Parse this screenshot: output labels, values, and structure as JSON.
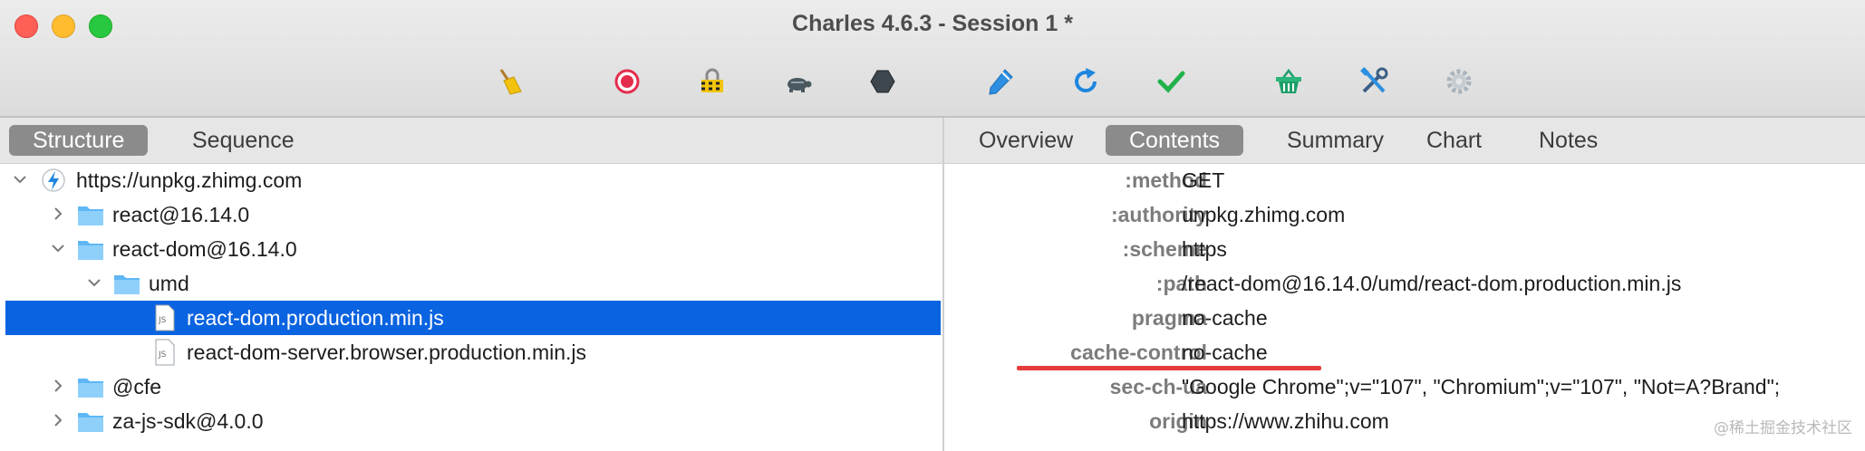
{
  "window": {
    "title": "Charles 4.6.3 - Session 1 *"
  },
  "toolbar": {
    "tools": [
      {
        "name": "broom-icon"
      },
      {
        "name": "record-icon"
      },
      {
        "name": "ssl-lock-icon"
      },
      {
        "name": "turtle-throttle-icon"
      },
      {
        "name": "stop-hexagon-icon"
      },
      {
        "name": "compose-pen-icon"
      },
      {
        "name": "repeat-refresh-icon"
      },
      {
        "name": "validate-check-icon"
      },
      {
        "name": "basket-icon"
      },
      {
        "name": "tools-icon"
      },
      {
        "name": "settings-gear-icon"
      }
    ]
  },
  "left_tabs": {
    "structure": "Structure",
    "sequence": "Sequence",
    "active": "Structure"
  },
  "tree": {
    "host": "https://unpkg.zhimg.com",
    "react": "react@16.14.0",
    "react_dom": "react-dom@16.14.0",
    "umd": "umd",
    "file_selected": "react-dom.production.min.js",
    "file_server": "react-dom-server.browser.production.min.js",
    "cfe": "@cfe",
    "za_sdk": "za-js-sdk@4.0.0",
    "js_badge": "JS"
  },
  "right_tabs": {
    "overview": "Overview",
    "contents": "Contents",
    "summary": "Summary",
    "chart": "Chart",
    "notes": "Notes",
    "active": "Contents"
  },
  "headers": [
    {
      "key": ":method",
      "value": "GET"
    },
    {
      "key": ":authority",
      "value": "unpkg.zhimg.com"
    },
    {
      "key": ":scheme",
      "value": "https"
    },
    {
      "key": ":path",
      "value": "/react-dom@16.14.0/umd/react-dom.production.min.js"
    },
    {
      "key": "pragma",
      "value": "no-cache"
    },
    {
      "key": "cache-control",
      "value": "no-cache"
    },
    {
      "key": "sec-ch-ua",
      "value": "\"Google Chrome\";v=\"107\", \"Chromium\";v=\"107\", \"Not=A?Brand\";"
    },
    {
      "key": "origin",
      "value": "https://www.zhihu.com"
    }
  ],
  "watermark": "@稀土掘金技术社区",
  "colors": {
    "selection": "#0a63e0",
    "highlight": "#e63b3b",
    "folder": "#5fb7f5"
  }
}
